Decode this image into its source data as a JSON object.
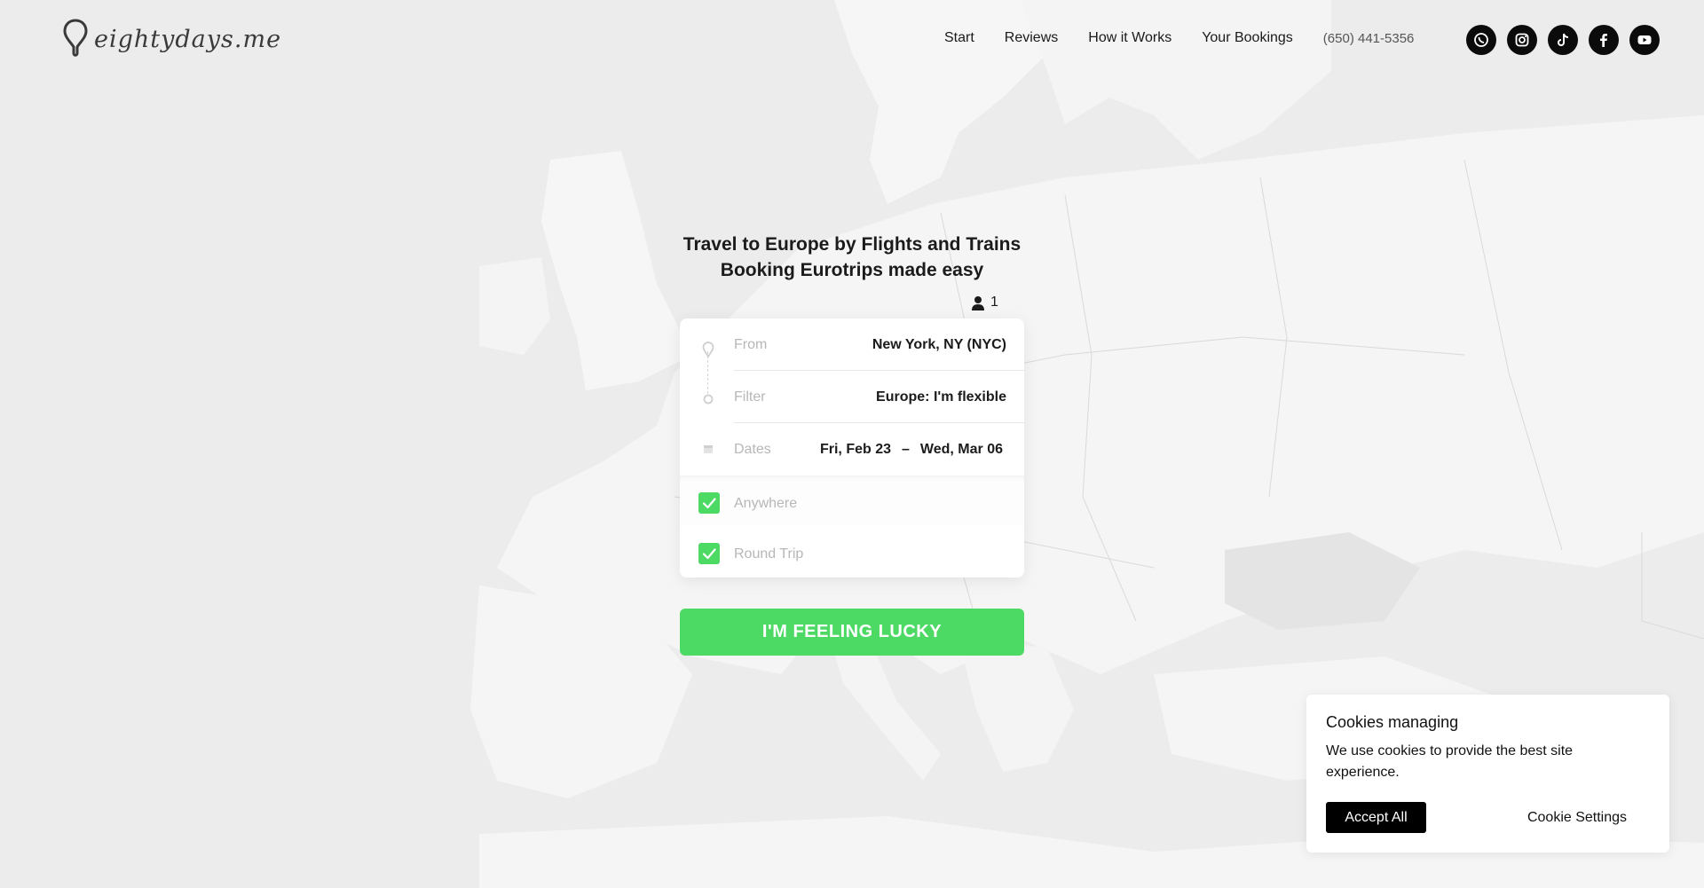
{
  "brand": {
    "name": "eightydays.me"
  },
  "nav": {
    "items": [
      {
        "label": "Start"
      },
      {
        "label": "Reviews"
      },
      {
        "label": "How it Works"
      },
      {
        "label": "Your Bookings"
      }
    ],
    "phone": "(650) 441-5356"
  },
  "socials": [
    "whatsapp-icon",
    "instagram-icon",
    "tiktok-icon",
    "facebook-icon",
    "youtube-icon"
  ],
  "hero": {
    "title_line1": "Travel to Europe by Flights and Trains",
    "title_line2": "Booking Eurotrips made easy",
    "passengers": "1"
  },
  "search": {
    "from_label": "From",
    "from_value": "New York, NY (NYC)",
    "filter_label": "Filter",
    "filter_value": "Europe: I'm flexible",
    "dates_label": "Dates",
    "date_start": "Fri, Feb 23",
    "date_sep": "–",
    "date_end": "Wed, Mar 06",
    "anywhere_label": "Anywhere",
    "anywhere_checked": true,
    "roundtrip_label": "Round Trip",
    "roundtrip_checked": true
  },
  "cta": {
    "label": "I'M FEELING LUCKY"
  },
  "cookies": {
    "title": "Cookies managing",
    "text": "We use cookies to provide the best site experience.",
    "accept_label": "Accept All",
    "settings_label": "Cookie Settings"
  },
  "colors": {
    "accent": "#4cd964",
    "background": "#ededed",
    "land": "#f5f5f5",
    "sea": "#e6e6e6",
    "text": "#1b1b1b"
  }
}
